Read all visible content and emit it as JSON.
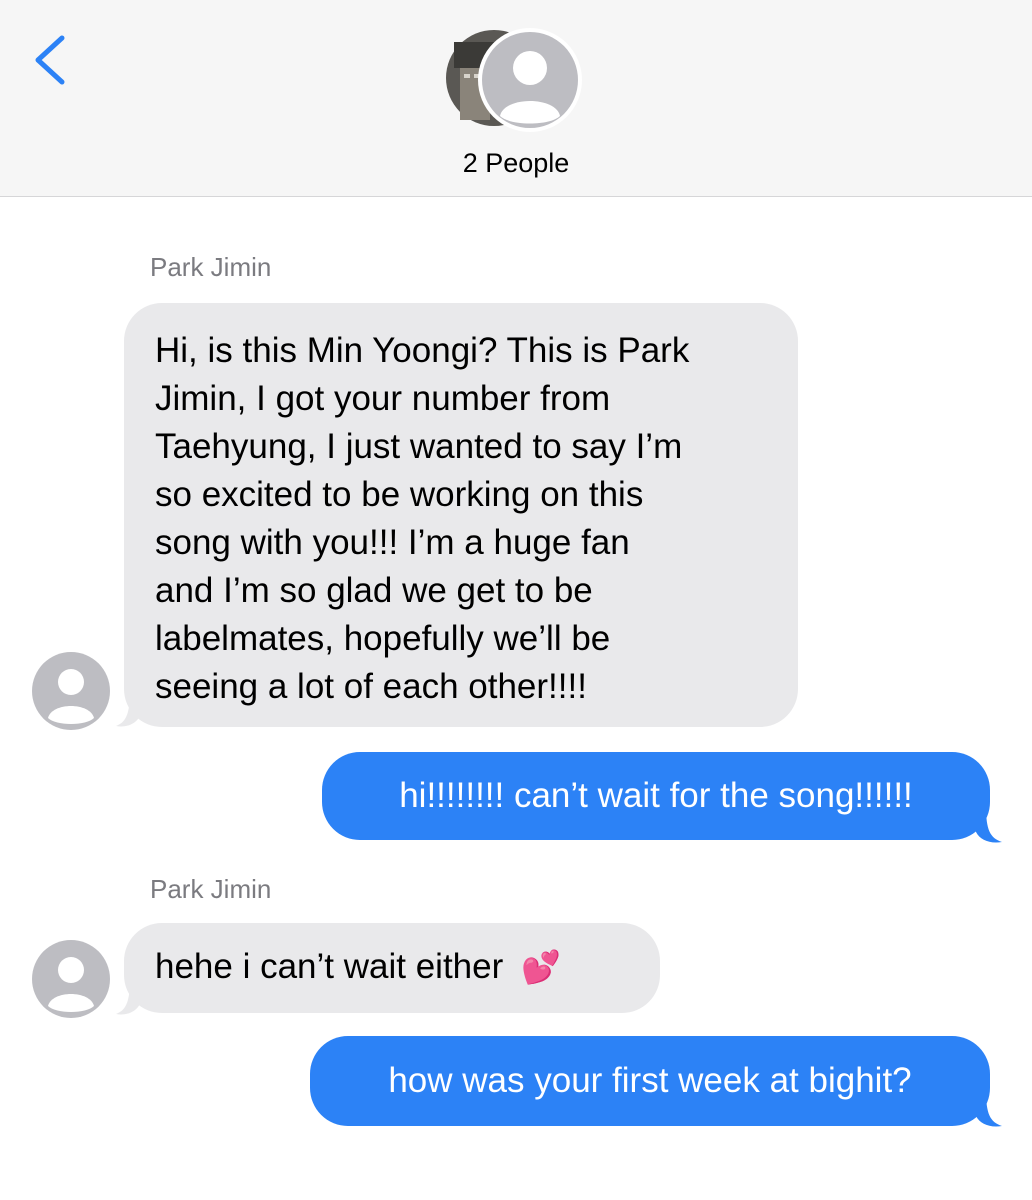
{
  "header": {
    "people_label": "2 People"
  },
  "messages": [
    {
      "sender": "Park Jimin",
      "direction": "incoming",
      "lines": [
        "Hi, is this Min Yoongi? This is Park",
        "Jimin, I got your number from",
        "Taehyung, I just wanted to say I’m",
        "so excited to be working on this",
        "song with you!!! I’m a huge fan",
        "and I’m so glad we get to be",
        "labelmates, hopefully we’ll be",
        "seeing a lot of each other!!!!"
      ]
    },
    {
      "direction": "outgoing",
      "text": "hi!!!!!!!! can’t wait for the song!!!!!!"
    },
    {
      "sender": "Park Jimin",
      "direction": "incoming",
      "text": "hehe i can’t wait either",
      "emoji": "💕"
    },
    {
      "direction": "outgoing",
      "text": "how was your first week at bighit?"
    }
  ],
  "colors": {
    "outgoing_bubble": "#2c82f6",
    "incoming_bubble": "#e9e9eb",
    "header_bg": "#f6f6f6",
    "back_chevron": "#2c82f6"
  },
  "icons": {
    "back": "chevron-left-icon",
    "avatar": "person-placeholder-icon"
  }
}
